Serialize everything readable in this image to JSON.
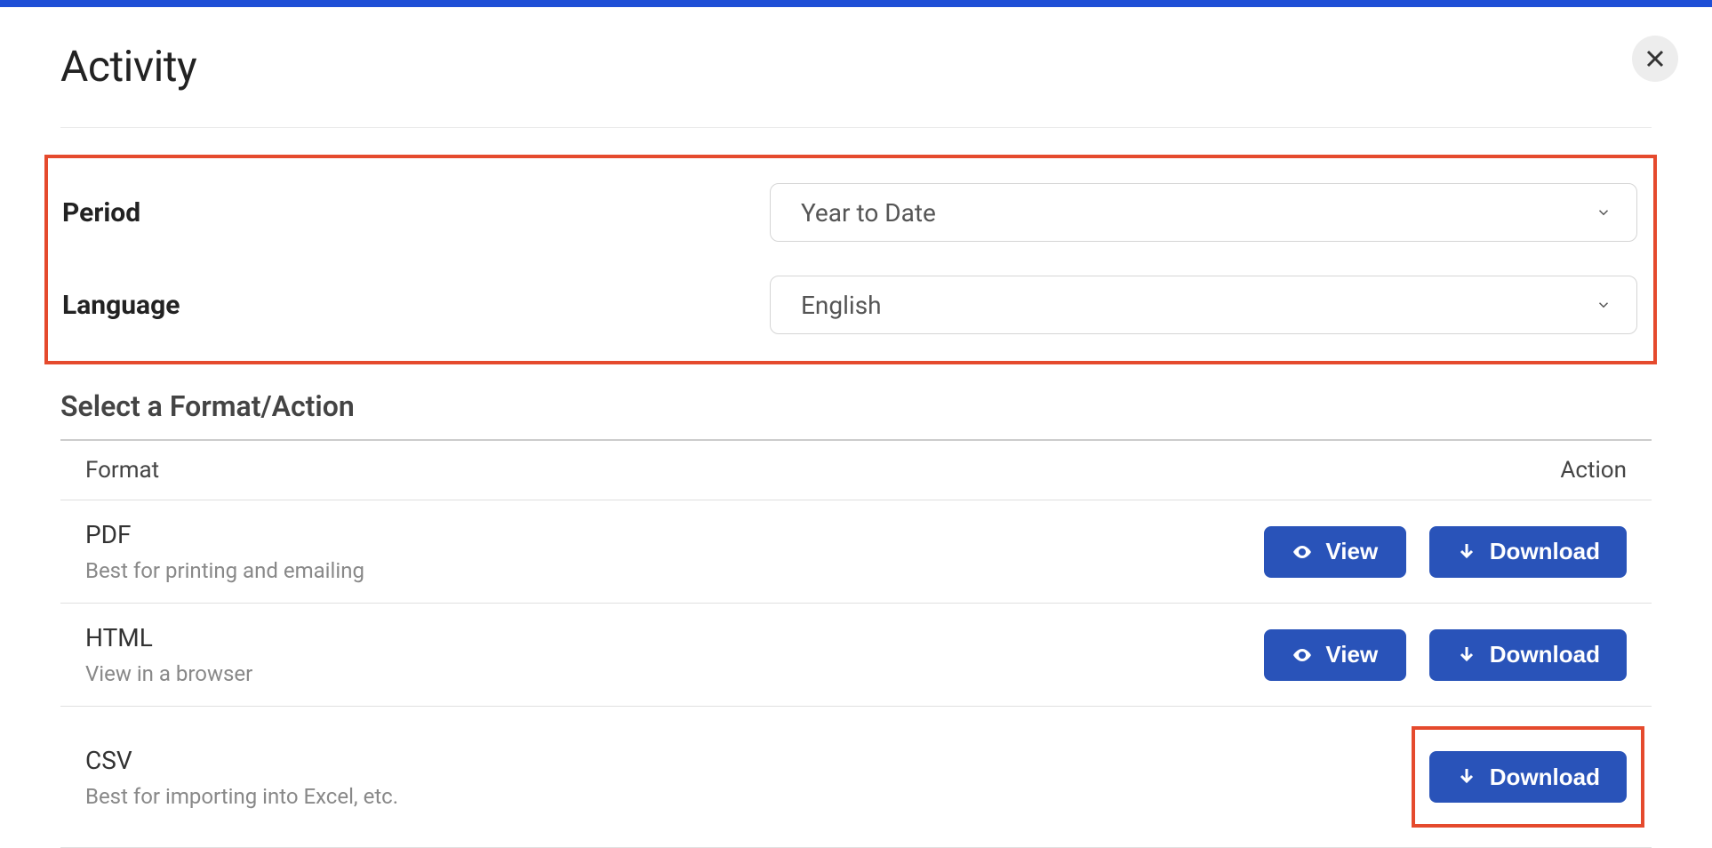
{
  "modal": {
    "title": "Activity"
  },
  "filters": {
    "period": {
      "label": "Period",
      "value": "Year to Date"
    },
    "language": {
      "label": "Language",
      "value": "English"
    }
  },
  "section": {
    "title": "Select a Format/Action",
    "headers": {
      "format": "Format",
      "action": "Action"
    }
  },
  "rows": [
    {
      "title": "PDF",
      "desc": "Best for printing and emailing",
      "viewLabel": "View",
      "downloadLabel": "Download",
      "hasView": true
    },
    {
      "title": "HTML",
      "desc": "View in a browser",
      "viewLabel": "View",
      "downloadLabel": "Download",
      "hasView": true
    },
    {
      "title": "CSV",
      "desc": "Best for importing into Excel, etc.",
      "downloadLabel": "Download",
      "hasView": false
    }
  ]
}
